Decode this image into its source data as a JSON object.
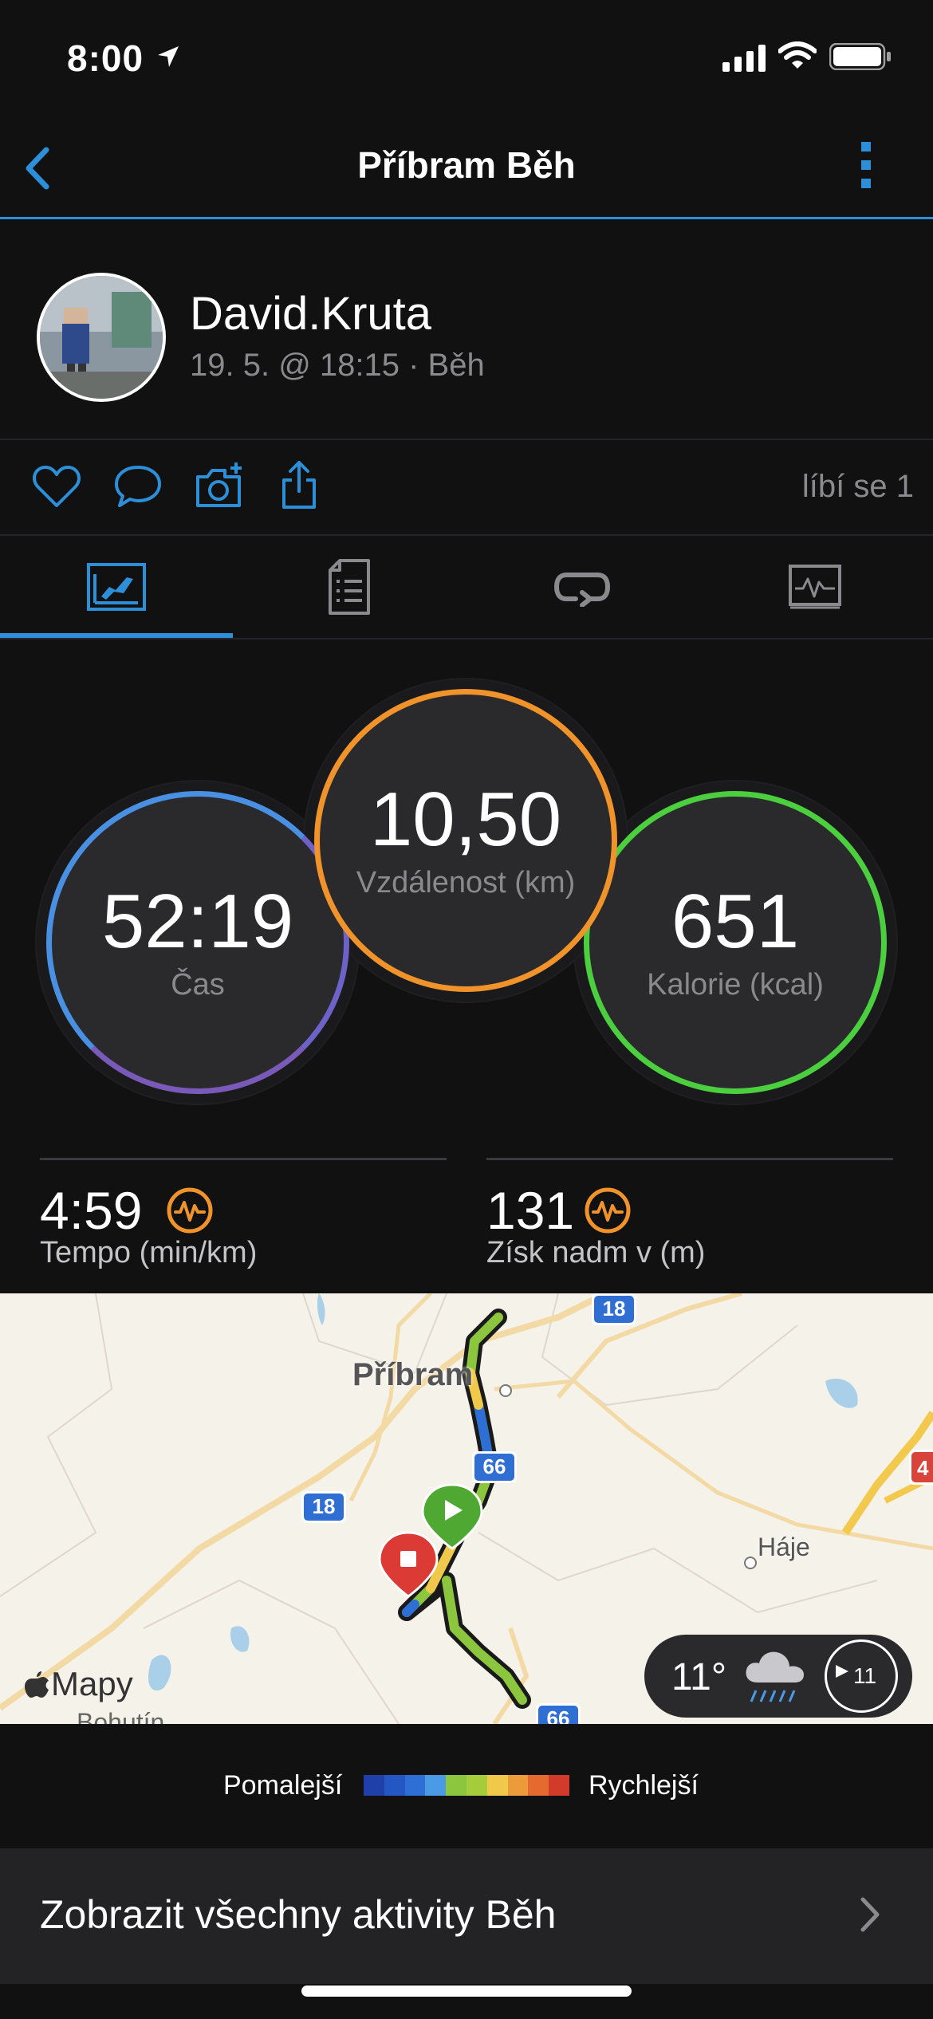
{
  "status_bar": {
    "time": "8:00"
  },
  "nav": {
    "title": "Příbram Běh"
  },
  "profile": {
    "username": "David.Kruta",
    "meta": "19. 5. @ 18:15 · Běh"
  },
  "actions": {
    "likes": "líbí se 1"
  },
  "tabs": [
    {
      "icon": "overview-icon",
      "active": true
    },
    {
      "icon": "details-icon",
      "active": false
    },
    {
      "icon": "laps-icon",
      "active": false
    },
    {
      "icon": "charts-icon",
      "active": false
    }
  ],
  "summary": {
    "time": {
      "value": "52:19",
      "label": "Čas"
    },
    "distance": {
      "value": "10,50",
      "label": "Vzdálenost (km)"
    },
    "calories": {
      "value": "651",
      "label": "Kalorie (kcal)"
    }
  },
  "stats": {
    "pace": {
      "value": "4:59",
      "label": "Tempo (min/km)"
    },
    "elevation": {
      "value": "131",
      "label": "Získ nadm v (m)"
    }
  },
  "map": {
    "attribution": "Mapy",
    "places": {
      "pribram": "Příbram",
      "haje": "Háje",
      "bohutin": "Bohutín"
    },
    "road_numbers": [
      "18",
      "66",
      "18",
      "66",
      "4"
    ],
    "weather": {
      "temperature": "11°",
      "wind": "11"
    }
  },
  "legend": {
    "slower": "Pomalejší",
    "faster": "Rychlejší",
    "colors": [
      "#1e40a8",
      "#2456c4",
      "#2e6fd6",
      "#4a9ae6",
      "#8cc63f",
      "#a5cc3a",
      "#f0c94a",
      "#ec9b3b",
      "#e46a2f",
      "#d23a2a"
    ]
  },
  "bottom": {
    "label": "Zobrazit všechny aktivity Běh"
  },
  "colors": {
    "accent": "#2d8fd8",
    "orange": "#f0932a",
    "green": "#4ccf3e",
    "blue": "#4a90e2"
  }
}
